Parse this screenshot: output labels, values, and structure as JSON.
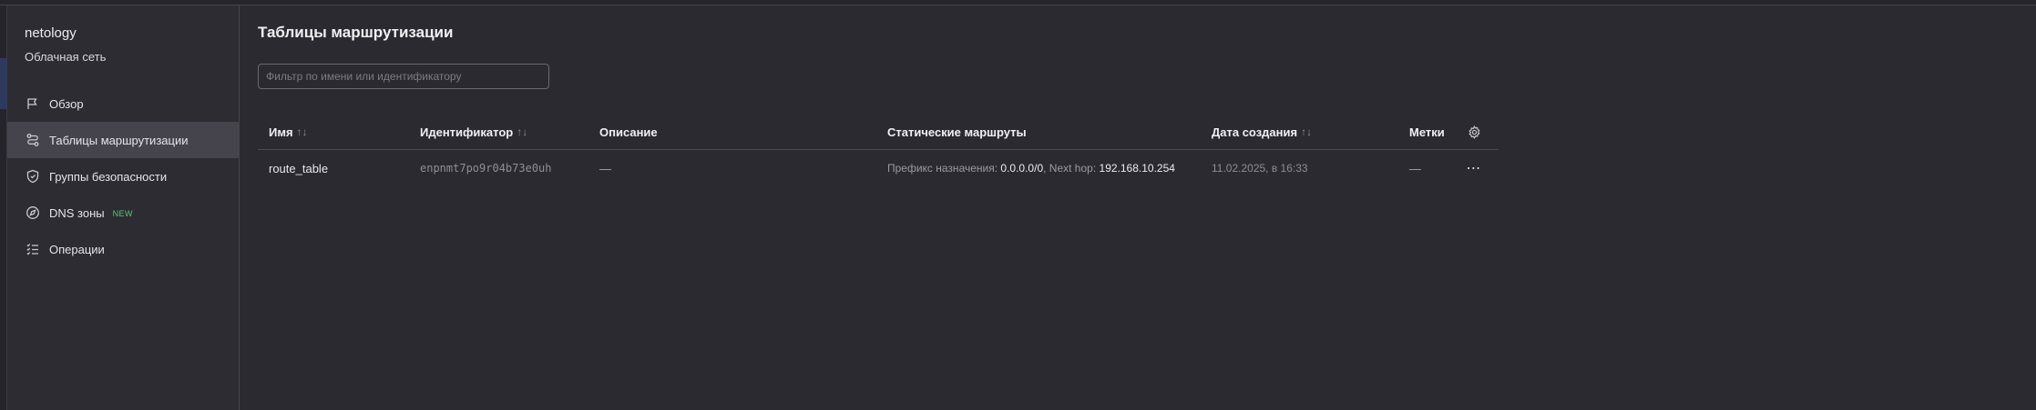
{
  "sidebar": {
    "project": "netology",
    "service": "Облачная сеть",
    "items": [
      {
        "label": "Обзор",
        "icon": "flag-icon"
      },
      {
        "label": "Таблицы маршрутизации",
        "icon": "route-icon",
        "active": true
      },
      {
        "label": "Группы безопасности",
        "icon": "shield-icon"
      },
      {
        "label": "DNS зоны",
        "icon": "compass-icon",
        "badge": "NEW"
      },
      {
        "label": "Операции",
        "icon": "list-icon"
      }
    ]
  },
  "main": {
    "title": "Таблицы маршрутизации",
    "filter_placeholder": "Фильтр по имени или идентификатору",
    "filter_value": ""
  },
  "table": {
    "columns": {
      "name": "Имя",
      "id": "Идентификатор",
      "description": "Описание",
      "routes": "Статические маршруты",
      "created": "Дата создания",
      "labels": "Метки"
    },
    "sort_glyph": "↑↓",
    "rows": [
      {
        "name": "route_table",
        "id": "enpnmt7po9r04b73e0uh",
        "description": "—",
        "routes_prefix_label": "Префикс назначения:",
        "routes_prefix_value": "0.0.0.0/0",
        "routes_sep": ", ",
        "routes_nexthop_label": "Next hop:",
        "routes_nexthop_value": "192.168.10.254",
        "created": "11.02.2025, в 16:33",
        "labels": "—",
        "more": "⋯"
      }
    ]
  },
  "colors": {
    "background": "#2b2a30",
    "sidebar": "#2d2c32",
    "active_item": "#45444c",
    "badge": "#59c87a"
  }
}
